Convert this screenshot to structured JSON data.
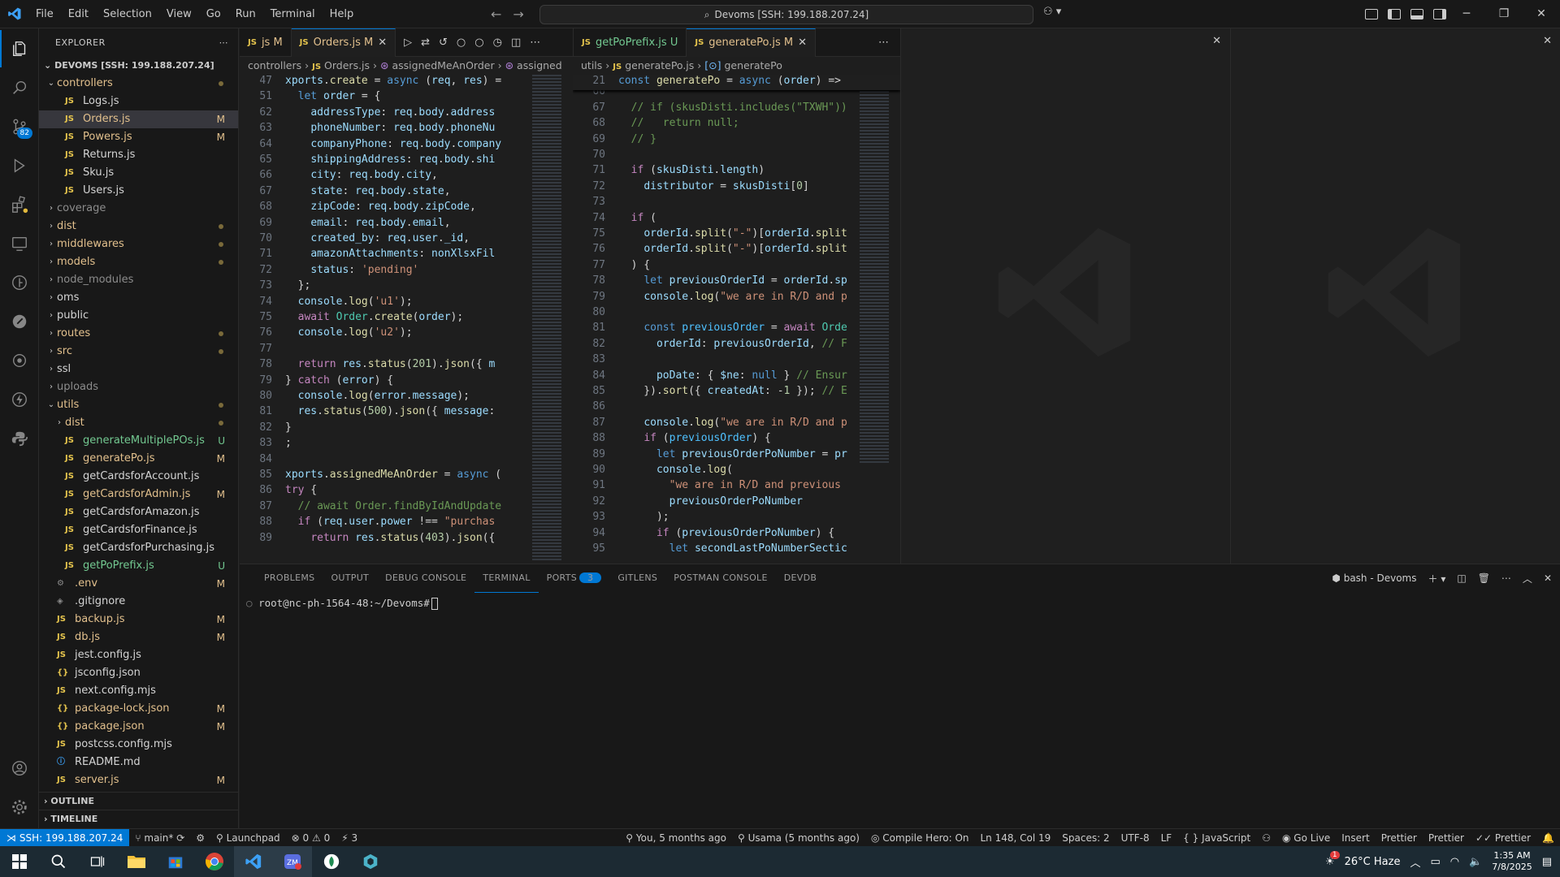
{
  "titlebar": {
    "menu": [
      "File",
      "Edit",
      "Selection",
      "View",
      "Go",
      "Run",
      "Terminal",
      "Help"
    ],
    "search": "Devoms [SSH: 199.188.207.24]"
  },
  "activity": {
    "scm_badge": "82"
  },
  "explorer": {
    "header": "EXPLORER",
    "root": "DEVOMS [SSH: 199.188.207.24]",
    "items": [
      {
        "label": "controllers",
        "type": "folder-open",
        "depth": 1,
        "cls": "mod",
        "dot": true
      },
      {
        "label": "Logs.js",
        "type": "js",
        "depth": 2,
        "cls": "pl"
      },
      {
        "label": "Orders.js",
        "type": "js",
        "depth": 2,
        "cls": "mod",
        "status": "M",
        "sel": true
      },
      {
        "label": "Powers.js",
        "type": "js",
        "depth": 2,
        "cls": "mod",
        "status": "M"
      },
      {
        "label": "Returns.js",
        "type": "js",
        "depth": 2,
        "cls": "pl"
      },
      {
        "label": "Sku.js",
        "type": "js",
        "depth": 2,
        "cls": "pl"
      },
      {
        "label": "Users.js",
        "type": "js",
        "depth": 2,
        "cls": "pl"
      },
      {
        "label": "coverage",
        "type": "folder",
        "depth": 1,
        "cls": "ign"
      },
      {
        "label": "dist",
        "type": "folder",
        "depth": 1,
        "cls": "mod",
        "dot": true
      },
      {
        "label": "middlewares",
        "type": "folder",
        "depth": 1,
        "cls": "mod",
        "dot": true
      },
      {
        "label": "models",
        "type": "folder",
        "depth": 1,
        "cls": "mod",
        "dot": true
      },
      {
        "label": "node_modules",
        "type": "folder",
        "depth": 1,
        "cls": "ign"
      },
      {
        "label": "oms",
        "type": "folder",
        "depth": 1,
        "cls": "pl"
      },
      {
        "label": "public",
        "type": "folder",
        "depth": 1,
        "cls": "pl"
      },
      {
        "label": "routes",
        "type": "folder",
        "depth": 1,
        "cls": "mod",
        "dot": true
      },
      {
        "label": "src",
        "type": "folder",
        "depth": 1,
        "cls": "mod",
        "dot": true
      },
      {
        "label": "ssl",
        "type": "folder",
        "depth": 1,
        "cls": "pl"
      },
      {
        "label": "uploads",
        "type": "folder",
        "depth": 1,
        "cls": "ign"
      },
      {
        "label": "utils",
        "type": "folder-open",
        "depth": 1,
        "cls": "mod",
        "dot": true
      },
      {
        "label": "dist",
        "type": "folder",
        "depth": 2,
        "cls": "mod",
        "dot": true
      },
      {
        "label": "generateMultiplePOs.js",
        "type": "js",
        "depth": 2,
        "cls": "unt",
        "status": "U"
      },
      {
        "label": "generatePo.js",
        "type": "js",
        "depth": 2,
        "cls": "mod",
        "status": "M"
      },
      {
        "label": "getCardsforAccount.js",
        "type": "js",
        "depth": 2,
        "cls": "pl"
      },
      {
        "label": "getCardsforAdmin.js",
        "type": "js",
        "depth": 2,
        "cls": "mod",
        "status": "M"
      },
      {
        "label": "getCardsforAmazon.js",
        "type": "js",
        "depth": 2,
        "cls": "pl"
      },
      {
        "label": "getCardsforFinance.js",
        "type": "js",
        "depth": 2,
        "cls": "pl"
      },
      {
        "label": "getCardsforPurchasing.js",
        "type": "js",
        "depth": 2,
        "cls": "pl"
      },
      {
        "label": "getPoPrefix.js",
        "type": "js",
        "depth": 2,
        "cls": "unt",
        "status": "U"
      },
      {
        "label": ".env",
        "type": "gear",
        "depth": 1,
        "cls": "mod",
        "status": "M"
      },
      {
        "label": ".gitignore",
        "type": "git",
        "depth": 1,
        "cls": "pl"
      },
      {
        "label": "backup.js",
        "type": "js",
        "depth": 1,
        "cls": "mod",
        "status": "M"
      },
      {
        "label": "db.js",
        "type": "js",
        "depth": 1,
        "cls": "mod",
        "status": "M"
      },
      {
        "label": "jest.config.js",
        "type": "js",
        "depth": 1,
        "cls": "pl"
      },
      {
        "label": "jsconfig.json",
        "type": "json",
        "depth": 1,
        "cls": "pl"
      },
      {
        "label": "next.config.mjs",
        "type": "js",
        "depth": 1,
        "cls": "pl"
      },
      {
        "label": "package-lock.json",
        "type": "json",
        "depth": 1,
        "cls": "mod",
        "status": "M"
      },
      {
        "label": "package.json",
        "type": "json",
        "depth": 1,
        "cls": "mod",
        "status": "M"
      },
      {
        "label": "postcss.config.mjs",
        "type": "js",
        "depth": 1,
        "cls": "pl"
      },
      {
        "label": "README.md",
        "type": "info",
        "depth": 1,
        "cls": "pl"
      },
      {
        "label": "server.js",
        "type": "js",
        "depth": 1,
        "cls": "mod",
        "status": "M"
      }
    ],
    "outline": "OUTLINE",
    "timeline": "TIMELINE"
  },
  "left_editor": {
    "tabs": [
      {
        "label": "js M",
        "active": false
      },
      {
        "label": "Orders.js M",
        "active": true
      }
    ],
    "breadcrumb": [
      "controllers",
      "Orders.js",
      "assignedMeAnOrder",
      "assigned"
    ],
    "lines": [
      {
        "n": "47",
        "html": "<span class='var'>xports</span><span class='pl'>.</span><span class='fn'>create</span><span class='pl'> = </span><span class='kw'>async</span><span class='pl'> (</span><span class='var'>req</span><span class='pl'>, </span><span class='var'>res</span><span class='pl'>) =</span>"
      },
      {
        "n": "51",
        "html": "<span class='pl'>  </span><span class='kw'>let</span><span class='pl'> </span><span class='var'>order</span><span class='pl'> = {</span>"
      },
      {
        "n": "62",
        "html": "<span class='pl'>    </span><span class='var'>addressType</span><span class='pl'>: </span><span class='var'>req</span><span class='pl'>.</span><span class='var'>body</span><span class='pl'>.</span><span class='var'>address</span>"
      },
      {
        "n": "63",
        "html": "<span class='pl'>    </span><span class='var'>phoneNumber</span><span class='pl'>: </span><span class='var'>req</span><span class='pl'>.</span><span class='var'>body</span><span class='pl'>.</span><span class='var'>phoneNu</span>"
      },
      {
        "n": "64",
        "html": "<span class='pl'>    </span><span class='var'>companyPhone</span><span class='pl'>: </span><span class='var'>req</span><span class='pl'>.</span><span class='var'>body</span><span class='pl'>.</span><span class='var'>company</span>"
      },
      {
        "n": "65",
        "html": "<span class='pl'>    </span><span class='var'>shippingAddress</span><span class='pl'>: </span><span class='var'>req</span><span class='pl'>.</span><span class='var'>body</span><span class='pl'>.</span><span class='var'>shi</span>"
      },
      {
        "n": "66",
        "html": "<span class='pl'>    </span><span class='var'>city</span><span class='pl'>: </span><span class='var'>req</span><span class='pl'>.</span><span class='var'>body</span><span class='pl'>.</span><span class='var'>city</span><span class='pl'>,</span>"
      },
      {
        "n": "67",
        "html": "<span class='pl'>    </span><span class='var'>state</span><span class='pl'>: </span><span class='var'>req</span><span class='pl'>.</span><span class='var'>body</span><span class='pl'>.</span><span class='var'>state</span><span class='pl'>,</span>"
      },
      {
        "n": "68",
        "html": "<span class='pl'>    </span><span class='var'>zipCode</span><span class='pl'>: </span><span class='var'>req</span><span class='pl'>.</span><span class='var'>body</span><span class='pl'>.</span><span class='var'>zipCode</span><span class='pl'>,</span>"
      },
      {
        "n": "69",
        "html": "<span class='pl'>    </span><span class='var'>email</span><span class='pl'>: </span><span class='var'>req</span><span class='pl'>.</span><span class='var'>body</span><span class='pl'>.</span><span class='var'>email</span><span class='pl'>,</span>"
      },
      {
        "n": "70",
        "html": "<span class='pl'>    </span><span class='var'>created_by</span><span class='pl'>: </span><span class='var'>req</span><span class='pl'>.</span><span class='var'>user</span><span class='pl'>.</span><span class='var'>_id</span><span class='pl'>,</span>"
      },
      {
        "n": "71",
        "html": "<span class='pl'>    </span><span class='var'>amazonAttachments</span><span class='pl'>: </span><span class='var'>nonXlsxFil</span>"
      },
      {
        "n": "72",
        "html": "<span class='pl'>    </span><span class='var'>status</span><span class='pl'>: </span><span class='str'>'pending'</span>"
      },
      {
        "n": "73",
        "html": "<span class='pl'>  };</span>"
      },
      {
        "n": "74",
        "html": "<span class='pl'>  </span><span class='var'>console</span><span class='pl'>.</span><span class='fn'>log</span><span class='pl'>(</span><span class='str'>'u1'</span><span class='pl'>);</span>"
      },
      {
        "n": "75",
        "html": "<span class='pl'>  </span><span class='ctl'>await</span><span class='pl'> </span><span class='cls'>Order</span><span class='pl'>.</span><span class='fn'>create</span><span class='pl'>(</span><span class='var'>order</span><span class='pl'>);</span>"
      },
      {
        "n": "76",
        "html": "<span class='pl'>  </span><span class='var'>console</span><span class='pl'>.</span><span class='fn'>log</span><span class='pl'>(</span><span class='str'>'u2'</span><span class='pl'>);</span>"
      },
      {
        "n": "77",
        "html": ""
      },
      {
        "n": "78",
        "html": "<span class='pl'>  </span><span class='ctl'>return</span><span class='pl'> </span><span class='var'>res</span><span class='pl'>.</span><span class='fn'>status</span><span class='pl'>(</span><span class='num'>201</span><span class='pl'>).</span><span class='fn'>json</span><span class='pl'>({ </span><span class='var'>m</span>"
      },
      {
        "n": "79",
        "html": "<span class='pl'>} </span><span class='ctl'>catch</span><span class='pl'> (</span><span class='var'>error</span><span class='pl'>) {</span>"
      },
      {
        "n": "80",
        "html": "<span class='pl'>  </span><span class='var'>console</span><span class='pl'>.</span><span class='fn'>log</span><span class='pl'>(</span><span class='var'>error</span><span class='pl'>.</span><span class='var'>message</span><span class='pl'>);</span>"
      },
      {
        "n": "81",
        "html": "<span class='pl'>  </span><span class='var'>res</span><span class='pl'>.</span><span class='fn'>status</span><span class='pl'>(</span><span class='num'>500</span><span class='pl'>).</span><span class='fn'>json</span><span class='pl'>({ </span><span class='var'>message</span><span class='pl'>:</span>"
      },
      {
        "n": "82",
        "html": "<span class='pl'>}</span>"
      },
      {
        "n": "83",
        "html": "<span class='pl'>;</span>"
      },
      {
        "n": "84",
        "html": ""
      },
      {
        "n": "85",
        "html": "<span class='var'>xports</span><span class='pl'>.</span><span class='fn'>assignedMeAnOrder</span><span class='pl'> = </span><span class='kw'>async</span><span class='pl'> (</span>"
      },
      {
        "n": "86",
        "html": "<span class='ctl'>try</span><span class='pl'> {</span>"
      },
      {
        "n": "87",
        "html": "<span class='pl'>  </span><span class='com'>// await Order.findByIdAndUpdate</span>"
      },
      {
        "n": "88",
        "html": "<span class='pl'>  </span><span class='ctl'>if</span><span class='pl'> (</span><span class='var'>req</span><span class='pl'>.</span><span class='var'>user</span><span class='pl'>.</span><span class='var'>power</span><span class='pl'> !== </span><span class='str'>\"purchas</span>"
      },
      {
        "n": "89",
        "html": "<span class='pl'>    </span><span class='ctl'>return</span><span class='pl'> </span><span class='var'>res</span><span class='pl'>.</span><span class='fn'>status</span><span class='pl'>(</span><span class='num'>403</span><span class='pl'>).</span><span class='fn'>json</span><span class='pl'>({</span>"
      }
    ]
  },
  "right_editor": {
    "tabs": [
      {
        "label": "getPoPrefix.js U",
        "active": false
      },
      {
        "label": "generatePo.js M",
        "active": true
      }
    ],
    "breadcrumb": [
      "utils",
      "generatePo.js",
      "generatePo"
    ],
    "sticky": {
      "n": "21",
      "html": "<span class='kw'>const</span><span class='pl'> </span><span class='fn'>generatePo</span><span class='pl'> = </span><span class='kw'>async</span><span class='pl'> (</span><span class='var'>order</span><span class='pl'>) =&gt;</span>"
    },
    "lines": [
      {
        "n": "66",
        "html": ""
      },
      {
        "n": "67",
        "html": "<span class='com'>  // if (skusDisti.includes(\"TXWH\"))</span>"
      },
      {
        "n": "68",
        "html": "<span class='com'>  //   return null;</span>"
      },
      {
        "n": "69",
        "html": "<span class='com'>  // }</span>"
      },
      {
        "n": "70",
        "html": ""
      },
      {
        "n": "71",
        "html": "<span class='pl'>  </span><span class='ctl'>if</span><span class='pl'> (</span><span class='var'>skusDisti</span><span class='pl'>.</span><span class='var'>length</span><span class='pl'>)</span>"
      },
      {
        "n": "72",
        "html": "<span class='pl'>    </span><span class='var'>distributor</span><span class='pl'> = </span><span class='var'>skusDisti</span><span class='pl'>[</span><span class='num'>0</span><span class='pl'>]</span>"
      },
      {
        "n": "73",
        "html": ""
      },
      {
        "n": "74",
        "html": "<span class='pl'>  </span><span class='ctl'>if</span><span class='pl'> (</span>"
      },
      {
        "n": "75",
        "html": "<span class='pl'>    </span><span class='var'>orderId</span><span class='pl'>.</span><span class='fn'>split</span><span class='pl'>(</span><span class='str'>\"-\"</span><span class='pl'>)[</span><span class='var'>orderId</span><span class='pl'>.</span><span class='fn'>split</span>"
      },
      {
        "n": "76",
        "html": "<span class='pl'>    </span><span class='var'>orderId</span><span class='pl'>.</span><span class='fn'>split</span><span class='pl'>(</span><span class='str'>\"-\"</span><span class='pl'>)[</span><span class='var'>orderId</span><span class='pl'>.</span><span class='fn'>split</span>"
      },
      {
        "n": "77",
        "html": "<span class='pl'>  ) {</span>"
      },
      {
        "n": "78",
        "html": "<span class='pl'>    </span><span class='kw'>let</span><span class='pl'> </span><span class='var'>previousOrderId</span><span class='pl'> = </span><span class='var'>orderId</span><span class='pl'>.</span><span class='var'>sp</span>"
      },
      {
        "n": "79",
        "html": "<span class='pl'>    </span><span class='var'>console</span><span class='pl'>.</span><span class='fn'>log</span><span class='pl'>(</span><span class='str'>\"we are in R/D and p</span>"
      },
      {
        "n": "80",
        "html": ""
      },
      {
        "n": "81",
        "html": "<span class='pl'>    </span><span class='kw'>const</span><span class='pl'> </span><span class='cst'>previousOrder</span><span class='pl'> = </span><span class='ctl'>await</span><span class='pl'> </span><span class='cls'>Orde</span>"
      },
      {
        "n": "82",
        "html": "<span class='pl'>      </span><span class='var'>orderId</span><span class='pl'>: </span><span class='var'>previousOrderId</span><span class='pl'>, </span><span class='com'>// F</span>"
      },
      {
        "n": "83",
        "html": ""
      },
      {
        "n": "84",
        "html": "<span class='pl'>      </span><span class='var'>poDate</span><span class='pl'>: { </span><span class='var'>$ne</span><span class='pl'>: </span><span class='kw'>null</span><span class='pl'> } </span><span class='com'>// Ensur</span>"
      },
      {
        "n": "85",
        "html": "<span class='pl'>    }).</span><span class='fn'>sort</span><span class='pl'>({ </span><span class='var'>createdAt</span><span class='pl'>: -</span><span class='num'>1</span><span class='pl'> }); </span><span class='com'>// E</span>"
      },
      {
        "n": "86",
        "html": ""
      },
      {
        "n": "87",
        "html": "<span class='pl'>    </span><span class='var'>console</span><span class='pl'>.</span><span class='fn'>log</span><span class='pl'>(</span><span class='str'>\"we are in R/D and p</span>"
      },
      {
        "n": "88",
        "html": "<span class='pl'>    </span><span class='ctl'>if</span><span class='pl'> (</span><span class='cst'>previousOrder</span><span class='pl'>) {</span>"
      },
      {
        "n": "89",
        "html": "<span class='pl'>      </span><span class='kw'>let</span><span class='pl'> </span><span class='var'>previousOrderPoNumber</span><span class='pl'> = </span><span class='var'>pr</span>"
      },
      {
        "n": "90",
        "html": "<span class='pl'>      </span><span class='var'>console</span><span class='pl'>.</span><span class='fn'>log</span><span class='pl'>(</span>"
      },
      {
        "n": "91",
        "html": "<span class='pl'>        </span><span class='str'>\"we are in R/D and previous</span>"
      },
      {
        "n": "92",
        "html": "<span class='pl'>        </span><span class='var'>previousOrderPoNumber</span>"
      },
      {
        "n": "93",
        "html": "<span class='pl'>      );</span>"
      },
      {
        "n": "94",
        "html": "<span class='pl'>      </span><span class='ctl'>if</span><span class='pl'> (</span><span class='var'>previousOrderPoNumber</span><span class='pl'>) {</span>"
      },
      {
        "n": "95",
        "html": "<span class='pl'>        </span><span class='kw'>let</span><span class='pl'> </span><span class='var'>secondLastPoNumberSectic</span>"
      }
    ]
  },
  "panel": {
    "tabs": [
      "PROBLEMS",
      "OUTPUT",
      "DEBUG CONSOLE",
      "TERMINAL",
      "PORTS",
      "GITLENS",
      "POSTMAN CONSOLE",
      "DEVDB"
    ],
    "active": "TERMINAL",
    "ports_badge": "3",
    "shell": "bash - Devoms",
    "prompt": "root@nc-ph-1564-48:~/Devoms#"
  },
  "statusbar": {
    "remote": "SSH: 199.188.207.24",
    "branch": "main*",
    "launchpad": "Launchpad",
    "errors": "0",
    "warnings": "0",
    "ports": "3",
    "blame": "You, 5 months ago",
    "author": "Usama (5 months ago)",
    "compile": "Compile Hero: On",
    "position": "Ln 148, Col 19",
    "spaces": "Spaces: 2",
    "encoding": "UTF-8",
    "eol": "LF",
    "language": "JavaScript",
    "golive": "Go Live",
    "insert": "Insert",
    "prettier1": "Prettier",
    "prettier2": "Prettier",
    "prettier3": "Prettier"
  },
  "taskbar": {
    "weather": "26°C  Haze",
    "time": "1:35 AM",
    "date": "7/8/2025",
    "notif_badge": "1"
  },
  "colors": {
    "accent": "#0078d4",
    "modified": "#e2c08d",
    "untracked": "#73c991"
  }
}
